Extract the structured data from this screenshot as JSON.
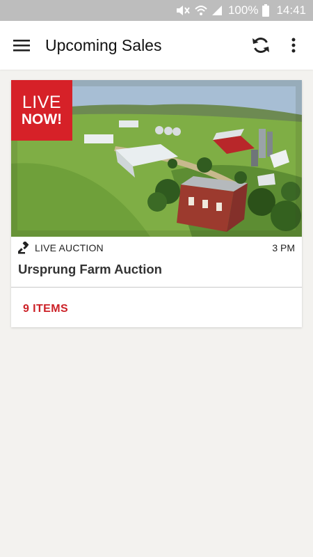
{
  "status_bar": {
    "battery": "100%",
    "time": "14:41",
    "icons": [
      "mute-icon",
      "wifi-icon",
      "signal-icon",
      "battery-icon"
    ]
  },
  "app_bar": {
    "title": "Upcoming Sales",
    "icons": [
      "menu-icon",
      "refresh-icon",
      "overflow-menu-icon"
    ]
  },
  "sale": {
    "badge_line1": "LIVE",
    "badge_line2": "NOW!",
    "type": "LIVE AUCTION",
    "time": "3 PM",
    "title": "Ursprung Farm Auction",
    "items": "9 ITEMS",
    "type_icon": "gavel-icon"
  },
  "colors": {
    "accent": "#d62128",
    "items_text": "#cc2127",
    "status_bar": "#bdbdbd",
    "background": "#f3f2ef"
  }
}
